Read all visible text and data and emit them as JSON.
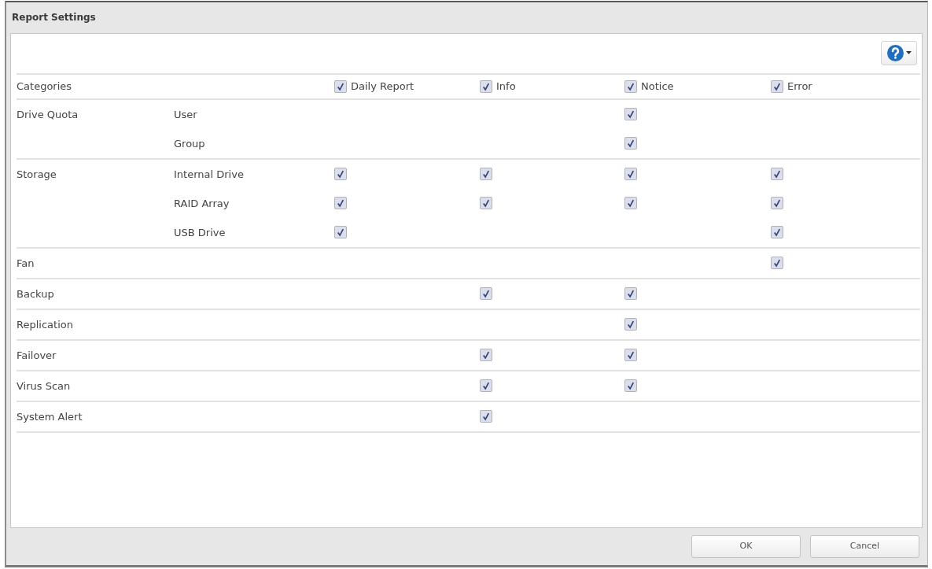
{
  "window": {
    "title": "Report Settings"
  },
  "header": {
    "label": "Categories",
    "columns": [
      {
        "label": "Daily Report",
        "checked": true
      },
      {
        "label": "Info",
        "checked": true
      },
      {
        "label": "Notice",
        "checked": true
      },
      {
        "label": "Error",
        "checked": true
      }
    ]
  },
  "groups": [
    {
      "label": "Drive Quota",
      "items": [
        {
          "label": "User",
          "cells": [
            {
              "kind": "empty"
            },
            {
              "kind": "empty"
            },
            {
              "kind": "checkbox",
              "checked": true
            },
            {
              "kind": "empty"
            }
          ]
        },
        {
          "label": "Group",
          "cells": [
            {
              "kind": "empty"
            },
            {
              "kind": "empty"
            },
            {
              "kind": "checkbox",
              "checked": true
            },
            {
              "kind": "empty"
            }
          ]
        }
      ]
    },
    {
      "label": "Storage",
      "items": [
        {
          "label": "Internal Drive",
          "cells": [
            {
              "kind": "checkbox",
              "checked": true
            },
            {
              "kind": "checkbox",
              "checked": true
            },
            {
              "kind": "checkbox",
              "checked": true
            },
            {
              "kind": "checkbox",
              "checked": true
            }
          ]
        },
        {
          "label": "RAID Array",
          "cells": [
            {
              "kind": "checkbox",
              "checked": true
            },
            {
              "kind": "checkbox",
              "checked": true
            },
            {
              "kind": "checkbox",
              "checked": true
            },
            {
              "kind": "checkbox",
              "checked": true
            }
          ]
        },
        {
          "label": "USB Drive",
          "cells": [
            {
              "kind": "checkbox",
              "checked": true
            },
            {
              "kind": "empty"
            },
            {
              "kind": "empty"
            },
            {
              "kind": "checkbox",
              "checked": true
            }
          ]
        }
      ]
    },
    {
      "label": "Fan",
      "items": [
        {
          "cells": [
            {
              "kind": "empty"
            },
            {
              "kind": "empty"
            },
            {
              "kind": "empty"
            },
            {
              "kind": "checkbox",
              "checked": true
            }
          ]
        }
      ]
    },
    {
      "label": "Backup",
      "items": [
        {
          "cells": [
            {
              "kind": "empty"
            },
            {
              "kind": "checkbox",
              "checked": true
            },
            {
              "kind": "checkbox",
              "checked": true
            },
            {
              "kind": "empty"
            }
          ]
        }
      ]
    },
    {
      "label": "Replication",
      "items": [
        {
          "cells": [
            {
              "kind": "empty"
            },
            {
              "kind": "empty"
            },
            {
              "kind": "checkbox",
              "checked": true
            },
            {
              "kind": "empty"
            }
          ]
        }
      ]
    },
    {
      "label": "Failover",
      "items": [
        {
          "cells": [
            {
              "kind": "empty"
            },
            {
              "kind": "checkbox",
              "checked": true
            },
            {
              "kind": "checkbox",
              "checked": true
            },
            {
              "kind": "empty"
            }
          ]
        }
      ]
    },
    {
      "label": "Virus Scan",
      "items": [
        {
          "cells": [
            {
              "kind": "empty"
            },
            {
              "kind": "checkbox",
              "checked": true
            },
            {
              "kind": "checkbox",
              "checked": true
            },
            {
              "kind": "empty"
            }
          ]
        }
      ]
    },
    {
      "label": "System Alert",
      "items": [
        {
          "cells": [
            {
              "kind": "empty"
            },
            {
              "kind": "checkbox",
              "checked": true
            },
            {
              "kind": "empty"
            },
            {
              "kind": "empty"
            }
          ]
        }
      ]
    }
  ],
  "buttons": [
    {
      "label": "OK"
    },
    {
      "label": "Cancel"
    }
  ]
}
